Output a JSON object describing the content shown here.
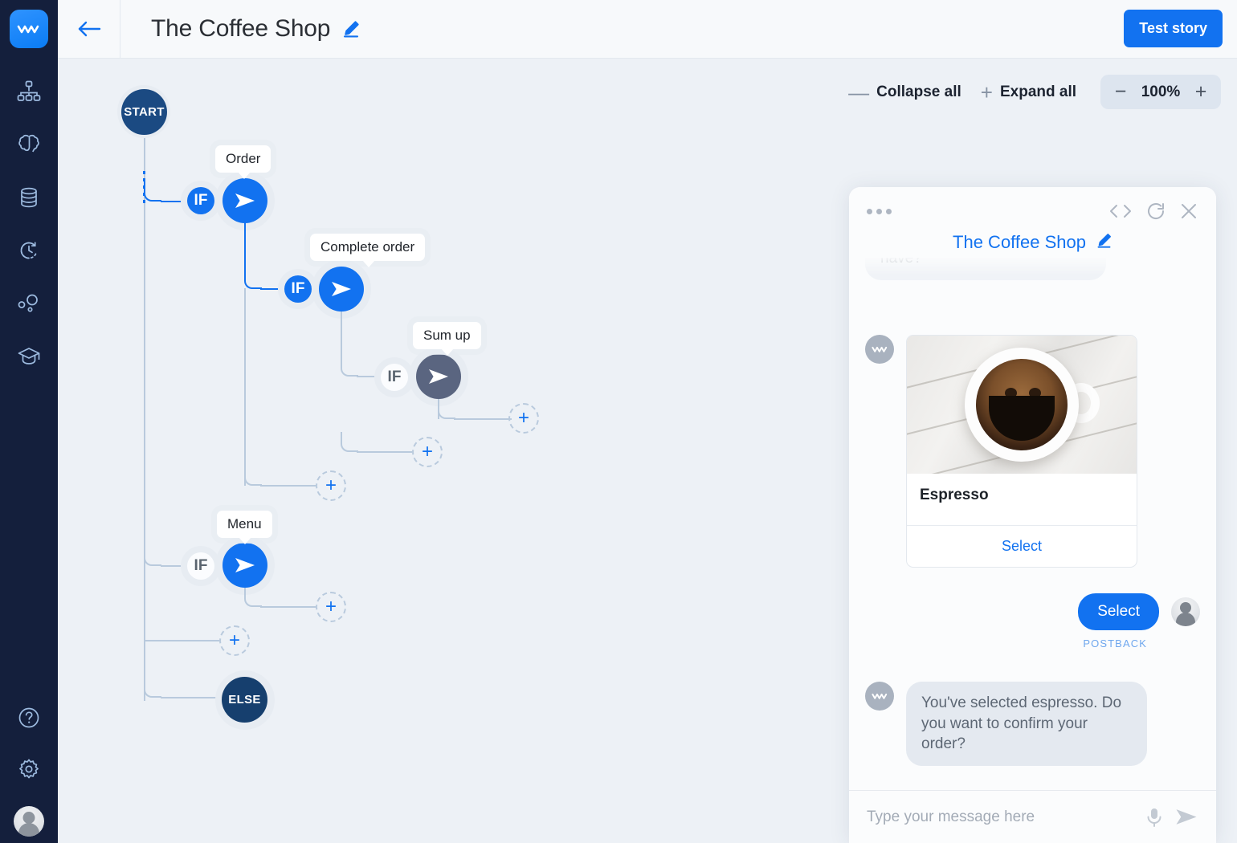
{
  "app": {
    "brand_color": "#1272f0",
    "rail_bg": "#141f3c",
    "canvas_bg": "#edf1f6"
  },
  "rail": {
    "logo_name": "flow-logo",
    "items": [
      {
        "icon": "sitemap-icon",
        "name": "sidebar-item-flows"
      },
      {
        "icon": "brain-icon",
        "name": "sidebar-item-nlp"
      },
      {
        "icon": "database-icon",
        "name": "sidebar-item-data"
      },
      {
        "icon": "history-icon",
        "name": "sidebar-item-history"
      },
      {
        "icon": "entities-icon",
        "name": "sidebar-item-entities"
      },
      {
        "icon": "graduation-cap-icon",
        "name": "sidebar-item-training"
      }
    ],
    "bottom": [
      {
        "icon": "help-icon",
        "name": "sidebar-item-help"
      },
      {
        "icon": "gear-icon",
        "name": "sidebar-item-settings"
      },
      {
        "icon": "avatar-icon",
        "name": "sidebar-item-account"
      }
    ]
  },
  "topbar": {
    "back_icon": "arrow-left-icon",
    "title": "The Coffee Shop",
    "edit_icon": "pencil-icon",
    "test_button": "Test story"
  },
  "canvas_tools": {
    "collapse_sign": "—",
    "collapse_label": "Collapse all",
    "expand_sign": "+",
    "expand_label": "Expand all",
    "zoom_out": "−",
    "zoom_value": "100%",
    "zoom_in": "+"
  },
  "flow": {
    "start_label": "START",
    "else_label": "ELSE",
    "if_label": "IF",
    "add_label": "+",
    "nodes": [
      {
        "id": "order",
        "label": "Order",
        "state": "active"
      },
      {
        "id": "complete_order",
        "label": "Complete order",
        "state": "active"
      },
      {
        "id": "sum_up",
        "label": "Sum up",
        "state": "muted"
      },
      {
        "id": "menu",
        "label": "Menu",
        "state": "active"
      }
    ]
  },
  "chat": {
    "header_icons": [
      "more-icon",
      "code-icon",
      "refresh-icon",
      "close-icon"
    ],
    "title": "The Coffee Shop",
    "edit_icon": "pencil-icon",
    "scrolled_message": "have?",
    "card": {
      "image_alt": "espresso-cup-photo",
      "title": "Espresso",
      "action": "Select"
    },
    "user_message": "Select",
    "postback_label": "POSTBACK",
    "bot_message": "You've selected espresso. Do you want to confirm your order?",
    "input_placeholder": "Type your message here",
    "mic_icon": "microphone-icon",
    "send_icon": "send-icon"
  }
}
